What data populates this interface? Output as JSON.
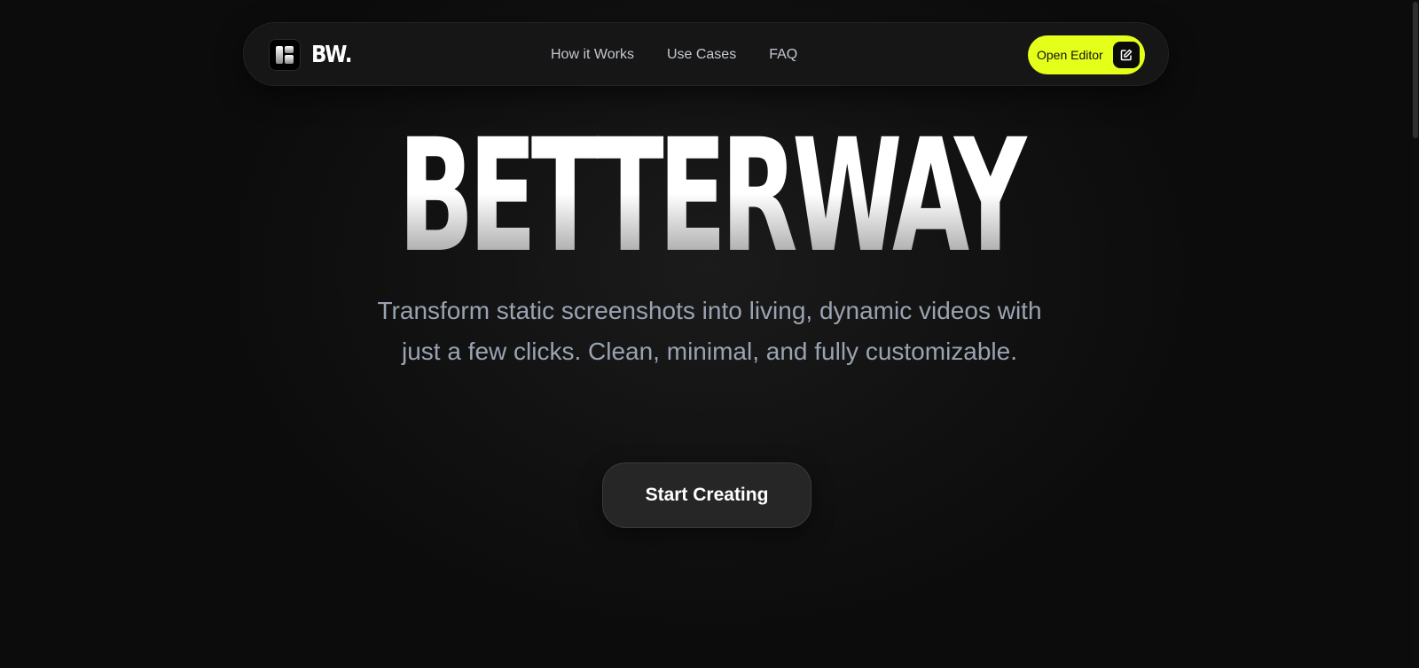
{
  "brand": {
    "name": "BW.",
    "logo_icon": "brand-logo-icon"
  },
  "nav": {
    "links": [
      {
        "label": "How it Works"
      },
      {
        "label": "Use Cases"
      },
      {
        "label": "FAQ"
      }
    ],
    "cta_label": "Open Editor",
    "cta_icon": "edit-icon"
  },
  "hero": {
    "title": "BETTERWAY",
    "subtitle": "Transform static screenshots into living, dynamic videos with just a few clicks. Clean, minimal, and fully customizable.",
    "cta_label": "Start Creating"
  },
  "colors": {
    "background": "#0d0d0d",
    "accent": "#e4ff1a",
    "subtitle_text": "#9aa3b2",
    "nav_text": "#c4c8d0"
  }
}
